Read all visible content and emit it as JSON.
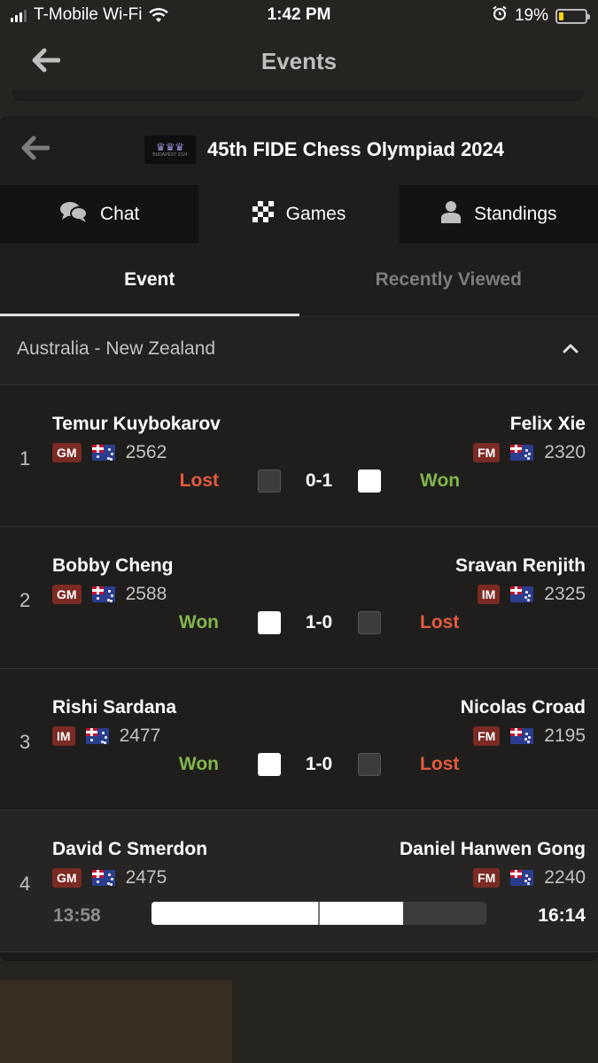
{
  "status_bar": {
    "carrier": "T-Mobile Wi-Fi",
    "time": "1:42 PM",
    "battery": "19%",
    "battery_level": 0.19
  },
  "header": {
    "title": "Events"
  },
  "event": {
    "title": "45th FIDE Chess Olympiad 2024",
    "logo_text": "BUDAPEST 2024"
  },
  "tabs": [
    {
      "label": "Chat",
      "icon": "chat-icon"
    },
    {
      "label": "Games",
      "icon": "chessboard-icon"
    },
    {
      "label": "Standings",
      "icon": "person-icon"
    }
  ],
  "subtabs": [
    {
      "label": "Event",
      "active": true
    },
    {
      "label": "Recently Viewed",
      "active": false
    }
  ],
  "group": {
    "name": "Australia - New Zealand"
  },
  "colors": {
    "won": "#81b64c",
    "lost": "#e45a3e",
    "badge": "#7b2a24"
  },
  "matches": [
    {
      "board": "1",
      "white": {
        "name": "Temur Kuybokarov",
        "title": "GM",
        "rating": "2562",
        "flag": "australia-flag"
      },
      "black": {
        "name": "Felix Xie",
        "title": "FM",
        "rating": "2320",
        "flag": "new-zealand-flag"
      },
      "left_result": "Lost",
      "right_result": "Won",
      "score": "0-1"
    },
    {
      "board": "2",
      "white": {
        "name": "Bobby Cheng",
        "title": "GM",
        "rating": "2588",
        "flag": "australia-flag"
      },
      "black": {
        "name": "Sravan Renjith",
        "title": "IM",
        "rating": "2325",
        "flag": "new-zealand-flag"
      },
      "left_result": "Won",
      "right_result": "Lost",
      "score": "1-0"
    },
    {
      "board": "3",
      "white": {
        "name": "Rishi Sardana",
        "title": "IM",
        "rating": "2477",
        "flag": "australia-flag"
      },
      "black": {
        "name": "Nicolas Croad",
        "title": "FM",
        "rating": "2195",
        "flag": "new-zealand-flag"
      },
      "left_result": "Won",
      "right_result": "Lost",
      "score": "1-0"
    },
    {
      "board": "4",
      "white": {
        "name": "David C Smerdon",
        "title": "GM",
        "rating": "2475",
        "flag": "australia-flag"
      },
      "black": {
        "name": "Daniel Hanwen Gong",
        "title": "FM",
        "rating": "2240",
        "flag": "new-zealand-flag"
      },
      "left_clock": "13:58",
      "right_clock": "16:14",
      "eval_white_fraction": 0.75
    }
  ]
}
